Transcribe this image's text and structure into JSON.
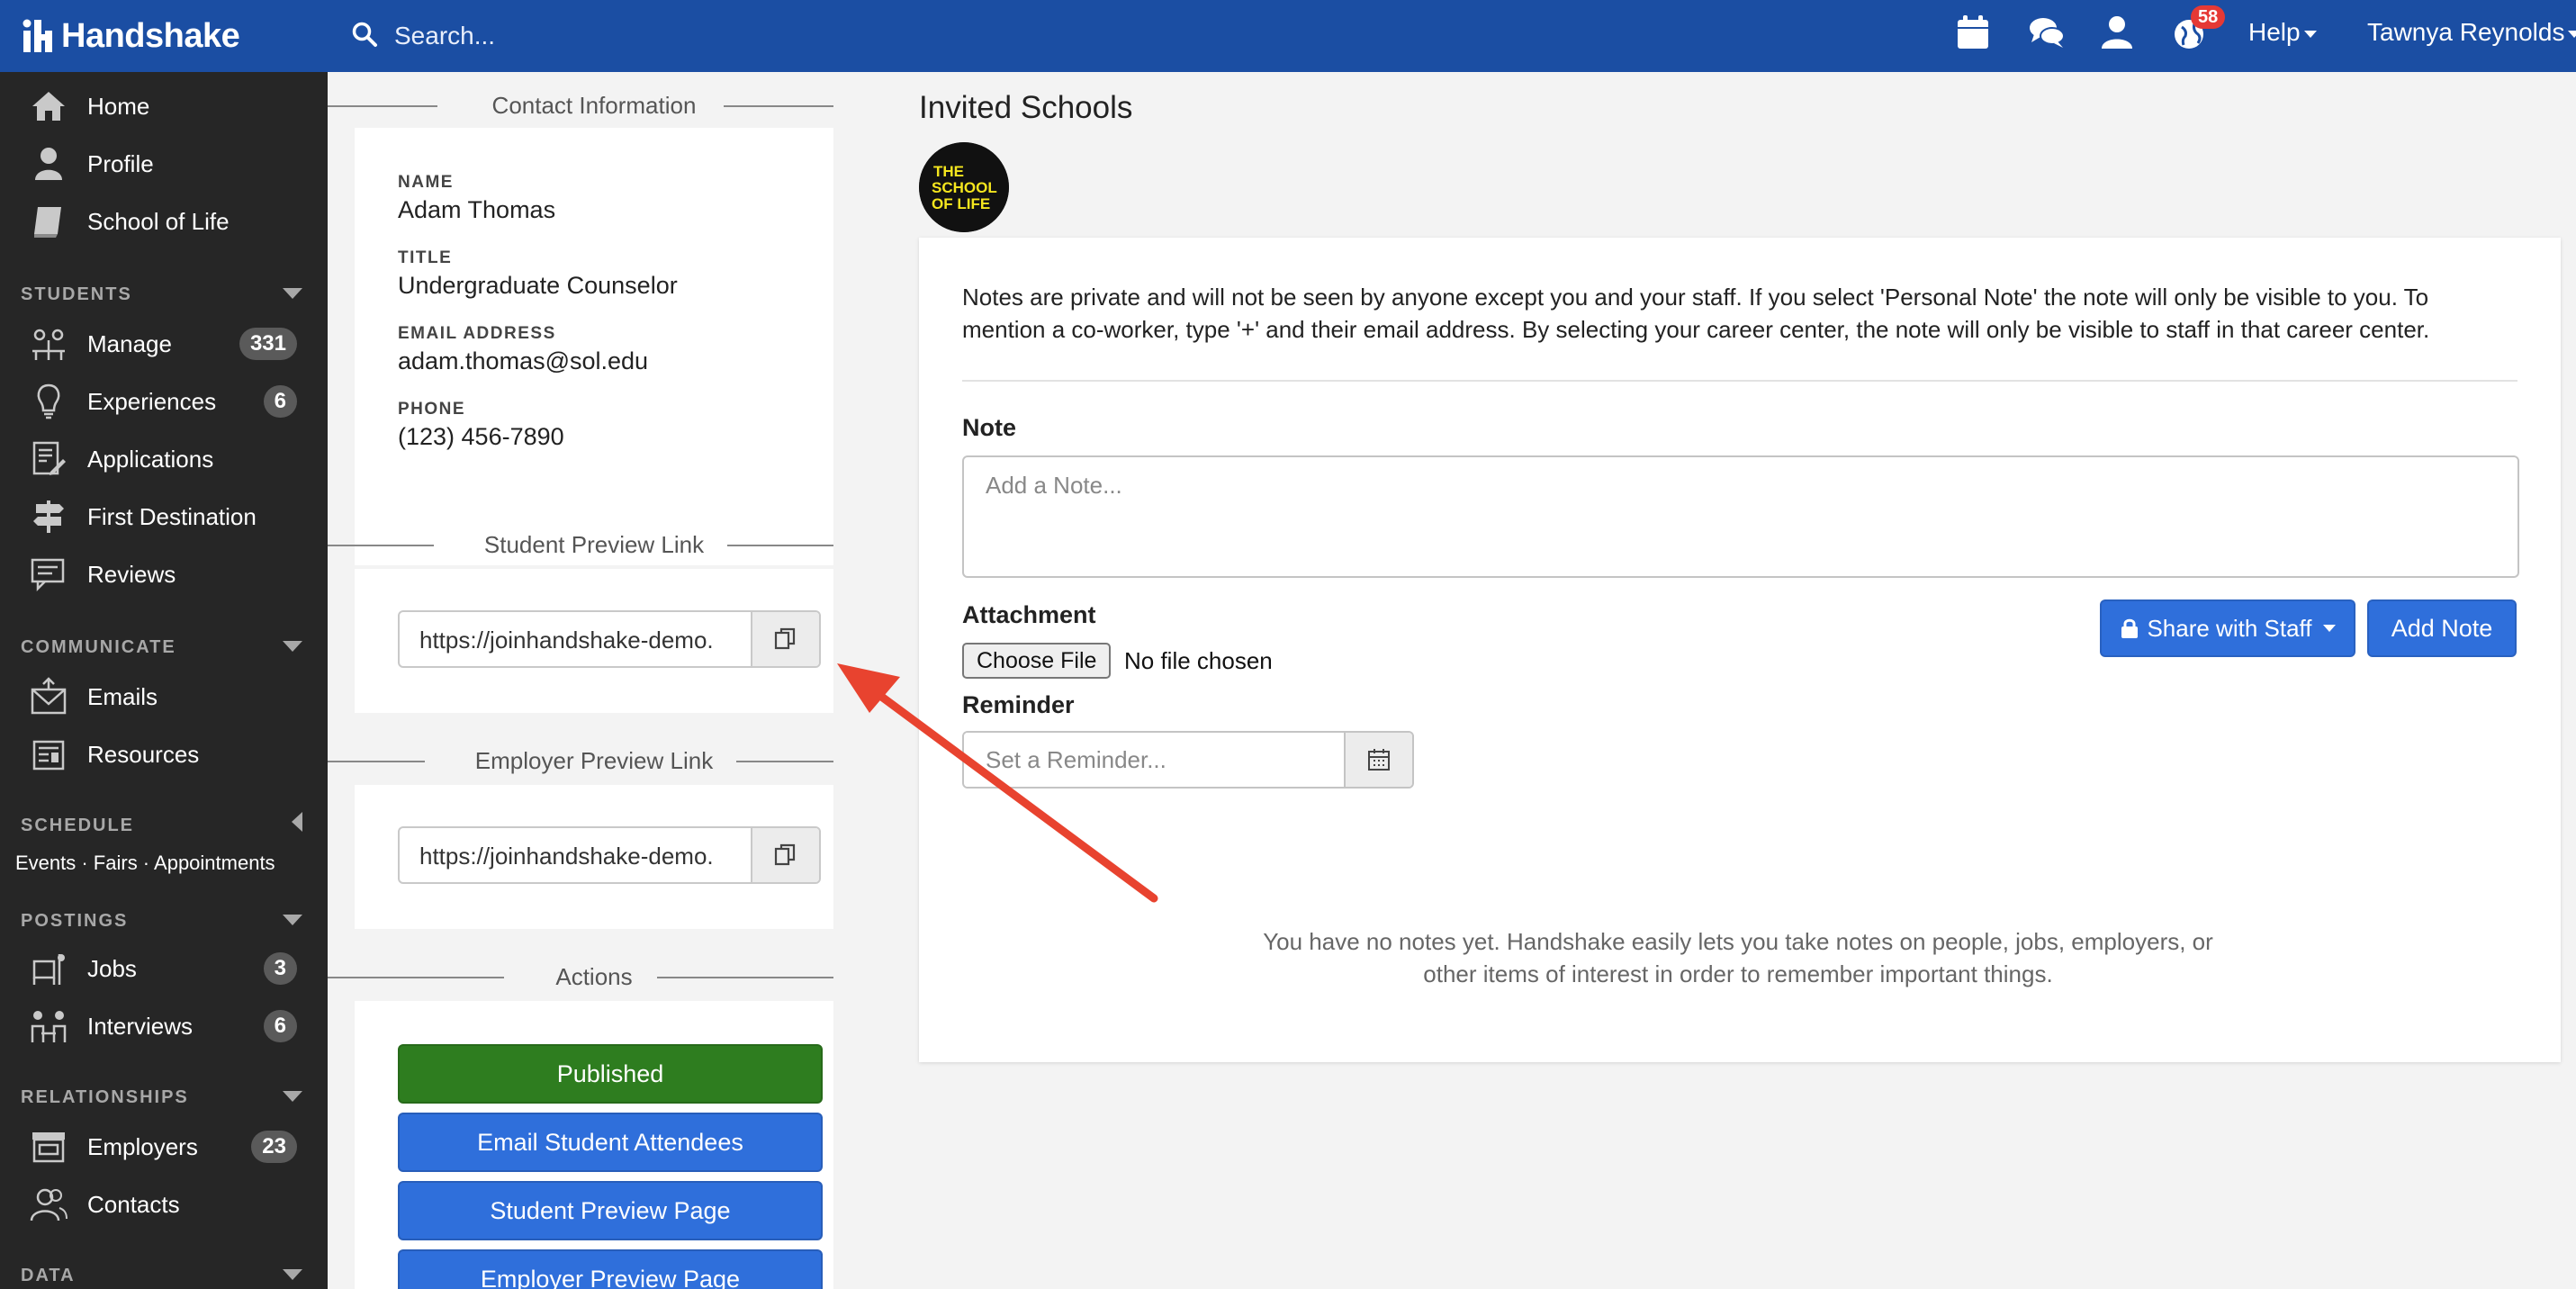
{
  "app": {
    "logo_text": "Handshake",
    "search_placeholder": "Search...",
    "notifications_count": "58",
    "help_label": "Help",
    "user_name": "Tawnya Reynolds"
  },
  "sidebar": {
    "top_items": [
      {
        "label": "Home",
        "icon": "home-icon"
      },
      {
        "label": "Profile",
        "icon": "user-icon"
      },
      {
        "label": "School of Life",
        "icon": "book-icon"
      }
    ],
    "students": {
      "heading": "STUDENTS",
      "items": [
        {
          "label": "Manage",
          "count": "331",
          "icon": "students-icon"
        },
        {
          "label": "Experiences",
          "count": "6",
          "icon": "lightbulb-icon"
        },
        {
          "label": "Applications",
          "icon": "application-icon"
        },
        {
          "label": "First Destination",
          "icon": "signpost-icon"
        },
        {
          "label": "Reviews",
          "icon": "reviews-icon"
        }
      ]
    },
    "communicate": {
      "heading": "COMMUNICATE",
      "items": [
        {
          "label": "Emails",
          "icon": "mail-icon"
        },
        {
          "label": "Resources",
          "icon": "resources-icon"
        }
      ]
    },
    "schedule": {
      "heading": "SCHEDULE",
      "links": "Events · Fairs · Appointments"
    },
    "postings": {
      "heading": "POSTINGS",
      "items": [
        {
          "label": "Jobs",
          "count": "3",
          "icon": "jobs-icon"
        },
        {
          "label": "Interviews",
          "count": "6",
          "icon": "interviews-icon"
        }
      ]
    },
    "relationships": {
      "heading": "RELATIONSHIPS",
      "items": [
        {
          "label": "Employers",
          "count": "23",
          "icon": "storefront-icon"
        },
        {
          "label": "Contacts",
          "icon": "contacts-icon"
        }
      ]
    },
    "data": {
      "heading": "DATA"
    }
  },
  "contact": {
    "section_title": "Contact Information",
    "name_label": "NAME",
    "name": "Adam Thomas",
    "title_label": "TITLE",
    "title": "Undergraduate Counselor",
    "email_label": "EMAIL ADDRESS",
    "email": "adam.thomas@sol.edu",
    "phone_label": "PHONE",
    "phone": "(123) 456-7890"
  },
  "student_preview": {
    "section_title": "Student Preview Link",
    "url": "https://joinhandshake-demo."
  },
  "employer_preview": {
    "section_title": "Employer Preview Link",
    "url": "https://joinhandshake-demo."
  },
  "actions": {
    "section_title": "Actions",
    "published": "Published",
    "email_attendees": "Email Student Attendees",
    "student_preview_page": "Student Preview Page",
    "employer_preview_page": "Employer Preview Page"
  },
  "main": {
    "title": "Invited Schools",
    "school_logo_text": [
      "THE",
      "SCHOOL",
      "OF LIFE"
    ],
    "notes_info": "Notes are private and will not be seen by anyone except you and your staff. If you select 'Personal Note' the note will only be visible to you. To mention a co-worker, type '+' and their email address. By selecting your career center, the note will only be visible to staff in that career center.",
    "note_label": "Note",
    "note_placeholder": "Add a Note...",
    "attachment_label": "Attachment",
    "choose_file": "Choose File",
    "no_file": "No file chosen",
    "share_label": "Share with Staff",
    "add_note": "Add Note",
    "reminder_label": "Reminder",
    "reminder_placeholder": "Set a Reminder...",
    "empty_text": "You have no notes yet. Handshake easily lets you take notes on people, jobs, employers, or other items of interest in order to remember important things."
  },
  "colors": {
    "topbar": "#1b4ea3",
    "sidebar": "#262626",
    "primary_button": "#2f6fdb",
    "published_button": "#2e7d1f",
    "badge": "#e53935",
    "arrow": "#e8432f",
    "logo_yellow": "#f5e61e"
  }
}
